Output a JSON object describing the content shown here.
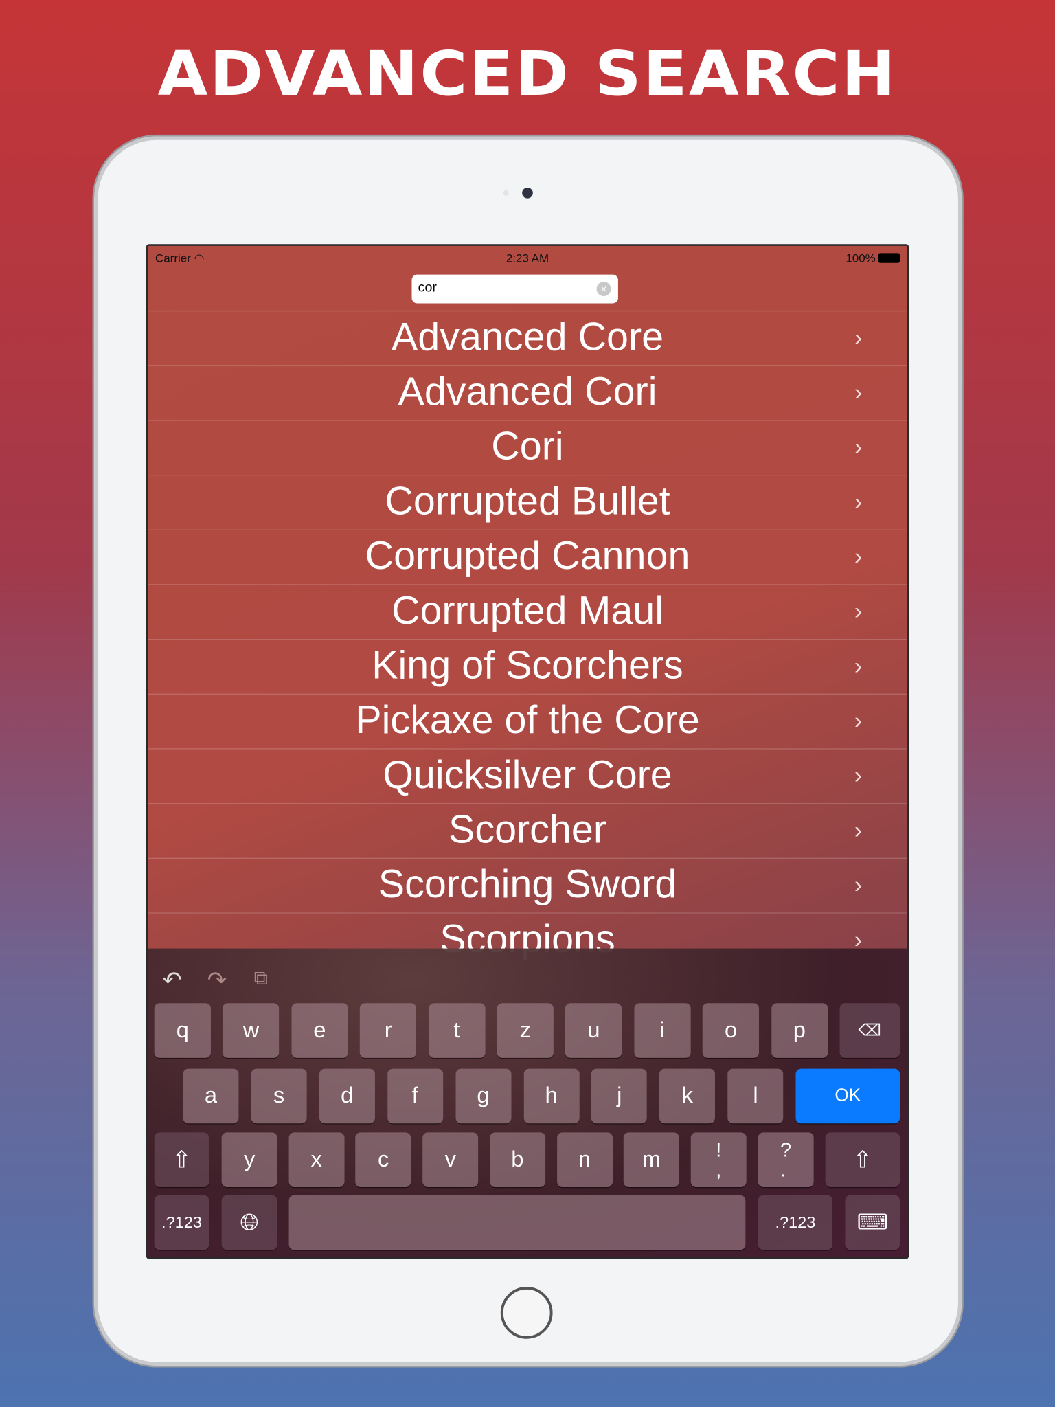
{
  "banner": {
    "title": "ADVANCED SEARCH"
  },
  "status": {
    "carrier": "Carrier",
    "time": "2:23 AM",
    "battery": "100%"
  },
  "search": {
    "value": "cor"
  },
  "results": [
    "Advanced Core",
    "Advanced Cori",
    "Cori",
    "Corrupted Bullet",
    "Corrupted Cannon",
    "Corrupted Maul",
    "King of Scorchers",
    "Pickaxe of the Core",
    "Quicksilver Core",
    "Scorcher",
    "Scorching Sword",
    "Scorpions"
  ],
  "keyboard": {
    "row1": [
      "q",
      "w",
      "e",
      "r",
      "t",
      "z",
      "u",
      "i",
      "o",
      "p"
    ],
    "row2": [
      "a",
      "s",
      "d",
      "f",
      "g",
      "h",
      "j",
      "k",
      "l"
    ],
    "row3": [
      "y",
      "x",
      "c",
      "v",
      "b",
      "n",
      "m"
    ],
    "ok": "OK",
    "num": ".?123",
    "punct1": "!\n,",
    "punct2": "?\n.",
    "accent": "#0a7bff"
  }
}
